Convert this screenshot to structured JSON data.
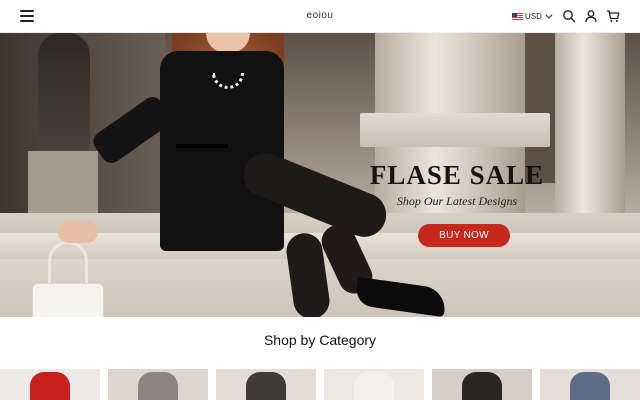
{
  "header": {
    "brand": "eoiou",
    "currency": "USD",
    "icons": [
      "menu-icon",
      "us-flag-icon",
      "chevron-down-icon",
      "search-icon",
      "user-icon",
      "cart-icon"
    ]
  },
  "hero": {
    "title": "FLASE SALE",
    "subtitle": "Shop Our Latest Designs",
    "cta_label": "BUY NOW",
    "cta_color": "#c8271d"
  },
  "categories": {
    "heading": "Shop by Category",
    "cards": [
      {
        "bg": "#ece9e6",
        "accent": "#c8201c"
      },
      {
        "bg": "#ddd6cf",
        "accent": "#8b8580"
      },
      {
        "bg": "#e3ddd6",
        "accent": "#3f3c38"
      },
      {
        "bg": "#ece8e3",
        "accent": "#f4f0ea"
      },
      {
        "bg": "#d7cec5",
        "accent": "#2a2624"
      },
      {
        "bg": "#e4dfd9",
        "accent": "#5d6d86"
      }
    ]
  }
}
